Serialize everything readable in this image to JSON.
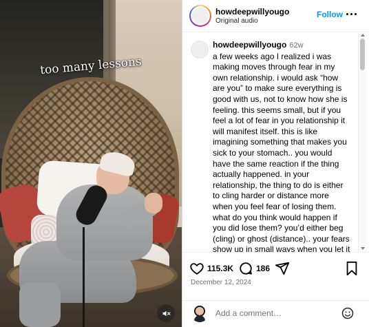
{
  "post": {
    "media": {
      "caption_overlay": "too many lessons",
      "mute_icon": "speaker-muted-icon"
    },
    "header": {
      "username": "howdeepwillyougo",
      "subtitle": "Original audio",
      "follow_label": "Follow",
      "more_icon": "more-horizontal-icon"
    },
    "comment": {
      "username": "howdeepwillyougo",
      "time_ago": "62w",
      "text": "a few weeks ago I realized i was making moves through fear in my own relationship. i would ask “how are you” to make sure everything is good with us, not to know how she is feeling. this seems small, but if you feel a lot of fear in you relationship it will manifest itself. this is like imagining something that makes you sick to your stomach.. you would have the same reaction if the thing actually happened. in your relationship, the thing to do is either to cling harder or distance more when you feel fear of losing them. what do you think would happen if you did lose them? you’d either beg (cling) or ghost (distance).. your fears show up in small ways when you let it consume you. but when you live through love, love can pour. How are"
    },
    "actions": {
      "likes": "115.3K",
      "comments": "186",
      "icons": [
        "heart-icon",
        "comment-icon",
        "share-icon",
        "bookmark-icon"
      ]
    },
    "date": "December 12, 2024",
    "add_comment": {
      "placeholder": "Add a comment…",
      "emoji_icon": "emoji-icon"
    }
  },
  "colors": {
    "follow_blue": "#0095f6",
    "meta_grey": "#737373"
  }
}
